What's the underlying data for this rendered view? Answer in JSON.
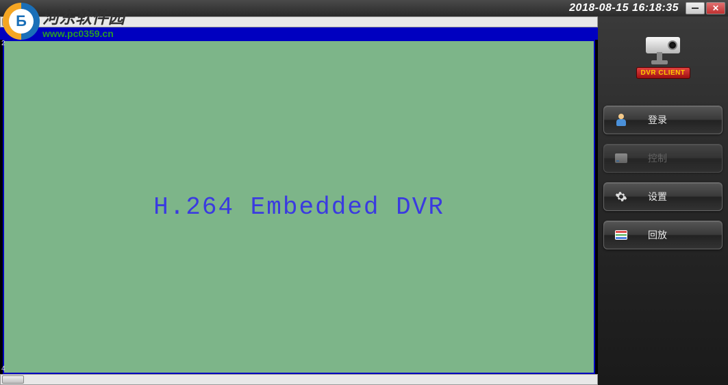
{
  "titlebar": {
    "timestamp": "2018-08-15 16:18:35"
  },
  "video": {
    "overlay_text": "H.264 Embedded DVR",
    "channel_labels": {
      "top": "2",
      "bottom": "4"
    }
  },
  "sidebar": {
    "logo_badge": "DVR CLIENT",
    "buttons": [
      {
        "label": "登录",
        "enabled": true
      },
      {
        "label": "控制",
        "enabled": false
      },
      {
        "label": "设置",
        "enabled": true
      },
      {
        "label": "回放",
        "enabled": true
      }
    ]
  },
  "watermark": {
    "title": "河东软件园",
    "url": "www.pc0359.cn",
    "logo_letter": "Б"
  }
}
